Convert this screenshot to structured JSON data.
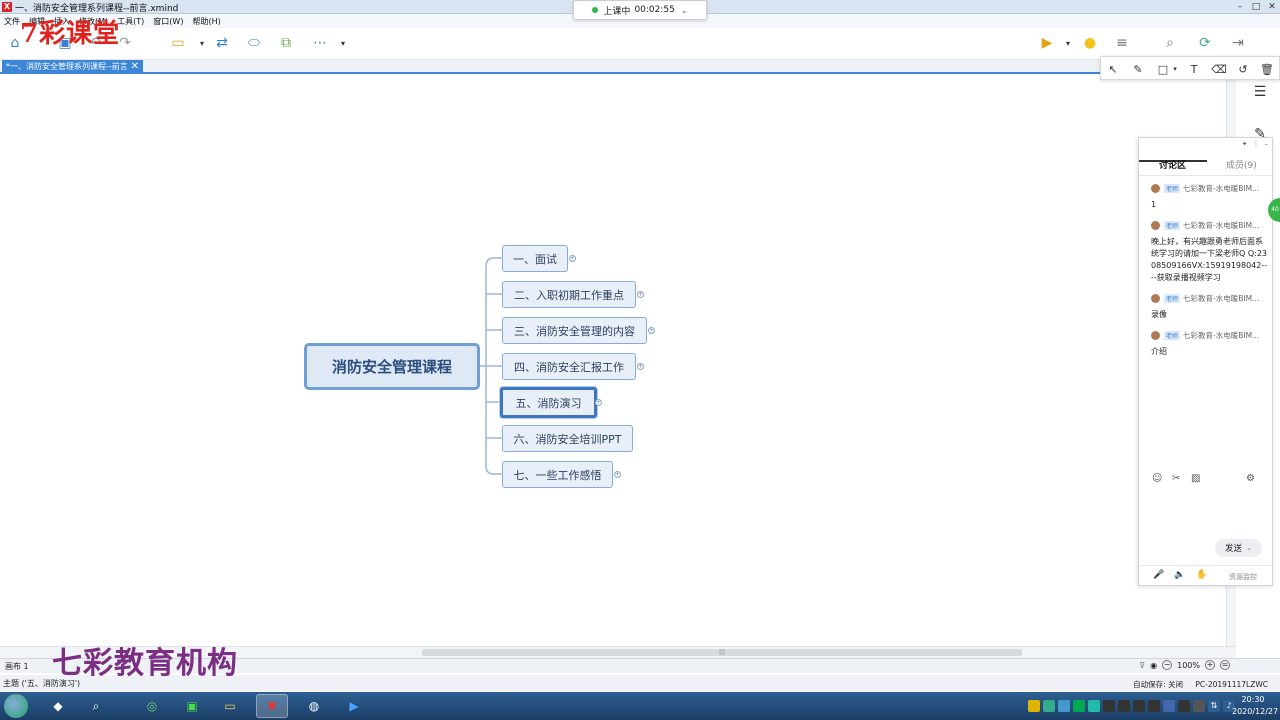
{
  "window": {
    "title": "一、消防安全管理系列课程--前言.xmind",
    "app_icon": "xmind-icon"
  },
  "menu": [
    "文件",
    "编辑",
    "插入",
    "修改(M)",
    "工具(T)",
    "窗口(W)",
    "帮助(H)"
  ],
  "watermark": {
    "top": "7彩课堂",
    "bottom": "七彩教育机构"
  },
  "live": {
    "status": "上课中",
    "time": "00:02:55"
  },
  "tab": {
    "label": "*一、消防安全管理系列课程--前言"
  },
  "mindmap": {
    "central": "消防安全管理课程",
    "topics": [
      {
        "label": "一、面试"
      },
      {
        "label": "二、入职初期工作重点"
      },
      {
        "label": "三、消防安全管理的内容"
      },
      {
        "label": "四、消防安全汇报工作"
      },
      {
        "label": "五、消防演习"
      },
      {
        "label": "六、消防安全培训PPT"
      },
      {
        "label": "七、一些工作感悟"
      }
    ],
    "selected_index": 4
  },
  "chat": {
    "tabs": [
      "讨论区",
      "成员(9)"
    ],
    "role_badge": "老师",
    "messages": [
      {
        "sender": "七彩教育-水电暖BIM...",
        "text": "1"
      },
      {
        "sender": "七彩教育-水电暖BIM...",
        "text": "晚上好，有兴趣跟勇老师后面系统学习的请加一下梁老师Q Q:2308509166VX:15919198042----获取录播视频学习"
      },
      {
        "sender": "七彩教育-水电暖BIM...",
        "text": "录像"
      },
      {
        "sender": "七彩教育-水电暖BIM...",
        "text": "介绍"
      }
    ],
    "send_label": "发送",
    "resource_monitor": "资源监控"
  },
  "status": {
    "sheet": "画布 1",
    "zoom": "100%",
    "topic": "主题 ('五、消防演习')",
    "autosave": "自动保存: 关闭",
    "pc": "PC-20191117LZWC"
  },
  "taskbar": {
    "time": "20:30",
    "date": "2020/12/27"
  }
}
